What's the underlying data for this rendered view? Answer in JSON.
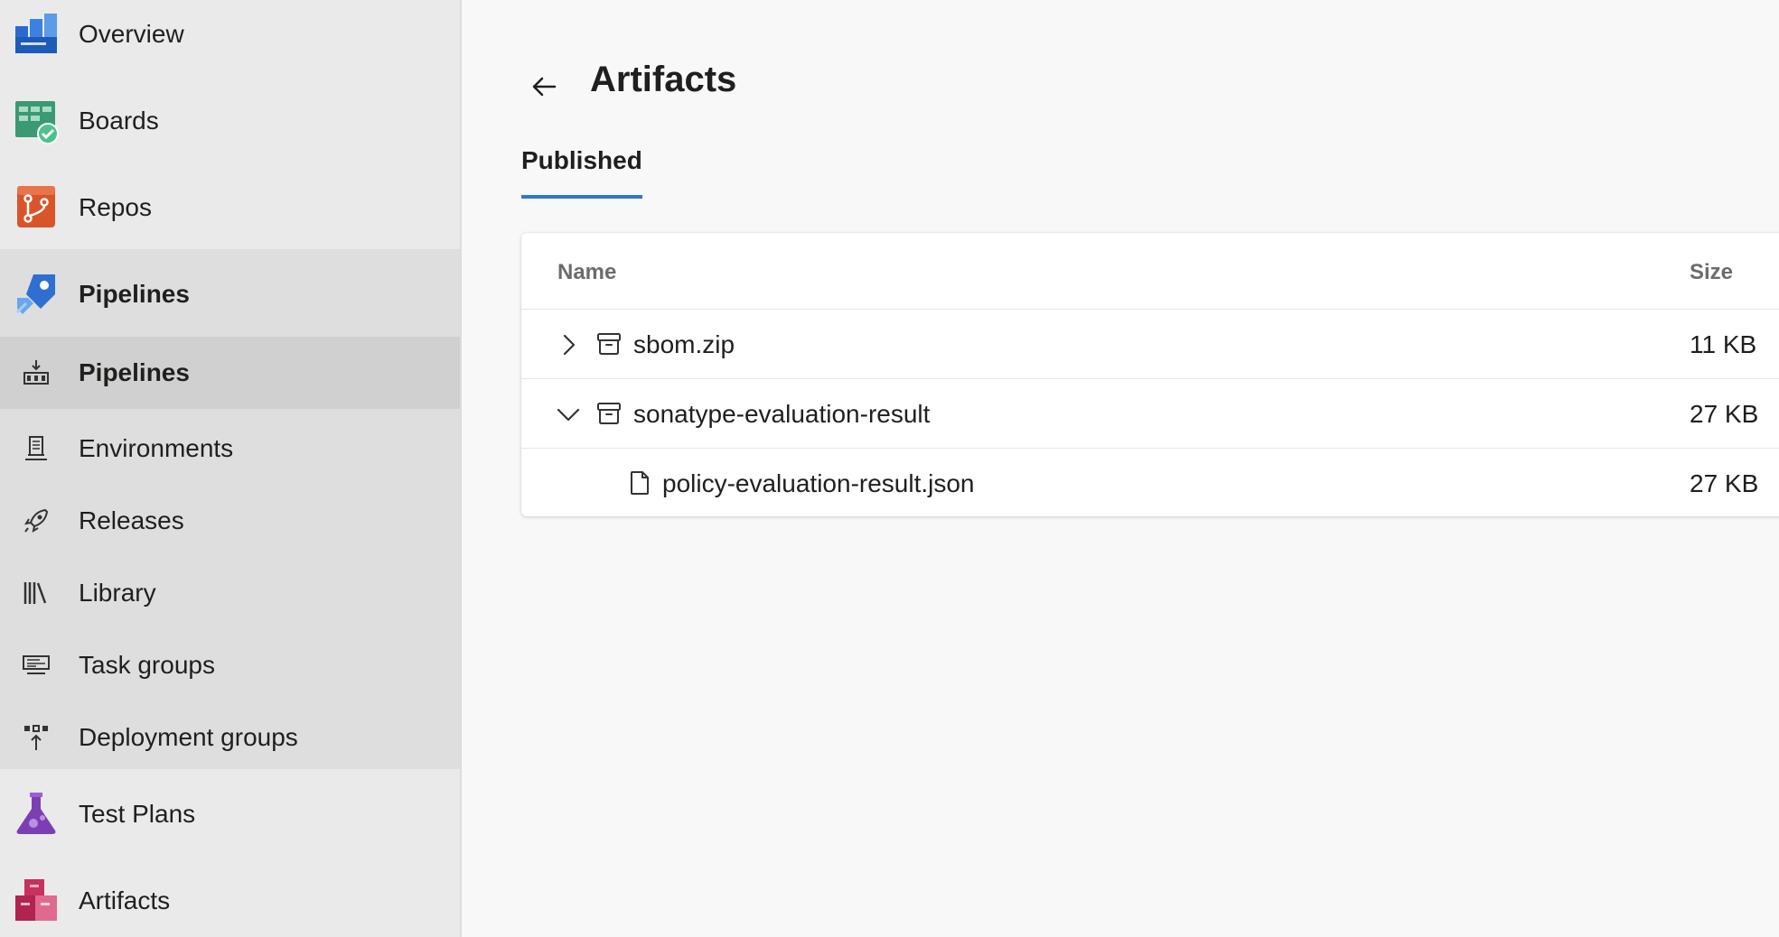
{
  "sidebar": {
    "items": [
      {
        "label": "Overview",
        "icon": "overview-icon"
      },
      {
        "label": "Boards",
        "icon": "boards-icon"
      },
      {
        "label": "Repos",
        "icon": "repos-icon"
      },
      {
        "label": "Pipelines",
        "icon": "pipelines-icon"
      },
      {
        "label": "Test Plans",
        "icon": "test-plans-icon"
      },
      {
        "label": "Artifacts",
        "icon": "artifacts-icon"
      }
    ],
    "pipelines_sub": [
      {
        "label": "Pipelines",
        "icon": "pipelines-sub-icon"
      },
      {
        "label": "Environments",
        "icon": "environments-icon"
      },
      {
        "label": "Releases",
        "icon": "releases-icon"
      },
      {
        "label": "Library",
        "icon": "library-icon"
      },
      {
        "label": "Task groups",
        "icon": "task-groups-icon"
      },
      {
        "label": "Deployment groups",
        "icon": "deployment-groups-icon"
      }
    ]
  },
  "main": {
    "title": "Artifacts",
    "tab": "Published",
    "table": {
      "headers": {
        "name": "Name",
        "size": "Size"
      },
      "rows": [
        {
          "name": "sbom.zip",
          "size": "11 KB",
          "expanded": false,
          "type": "artifact"
        },
        {
          "name": "sonatype-evaluation-result",
          "size": "27 KB",
          "expanded": true,
          "type": "artifact"
        },
        {
          "name": "policy-evaluation-result.json",
          "size": "27 KB",
          "type": "file"
        }
      ]
    }
  },
  "colors": {
    "accent": "#2f78c9",
    "overview": "#1e6fd1",
    "boards": "#2e9b6f",
    "repos": "#d8552a",
    "pipelines": "#2f6fd1",
    "test_plans": "#7b3fb3",
    "artifacts": "#c8305e"
  }
}
